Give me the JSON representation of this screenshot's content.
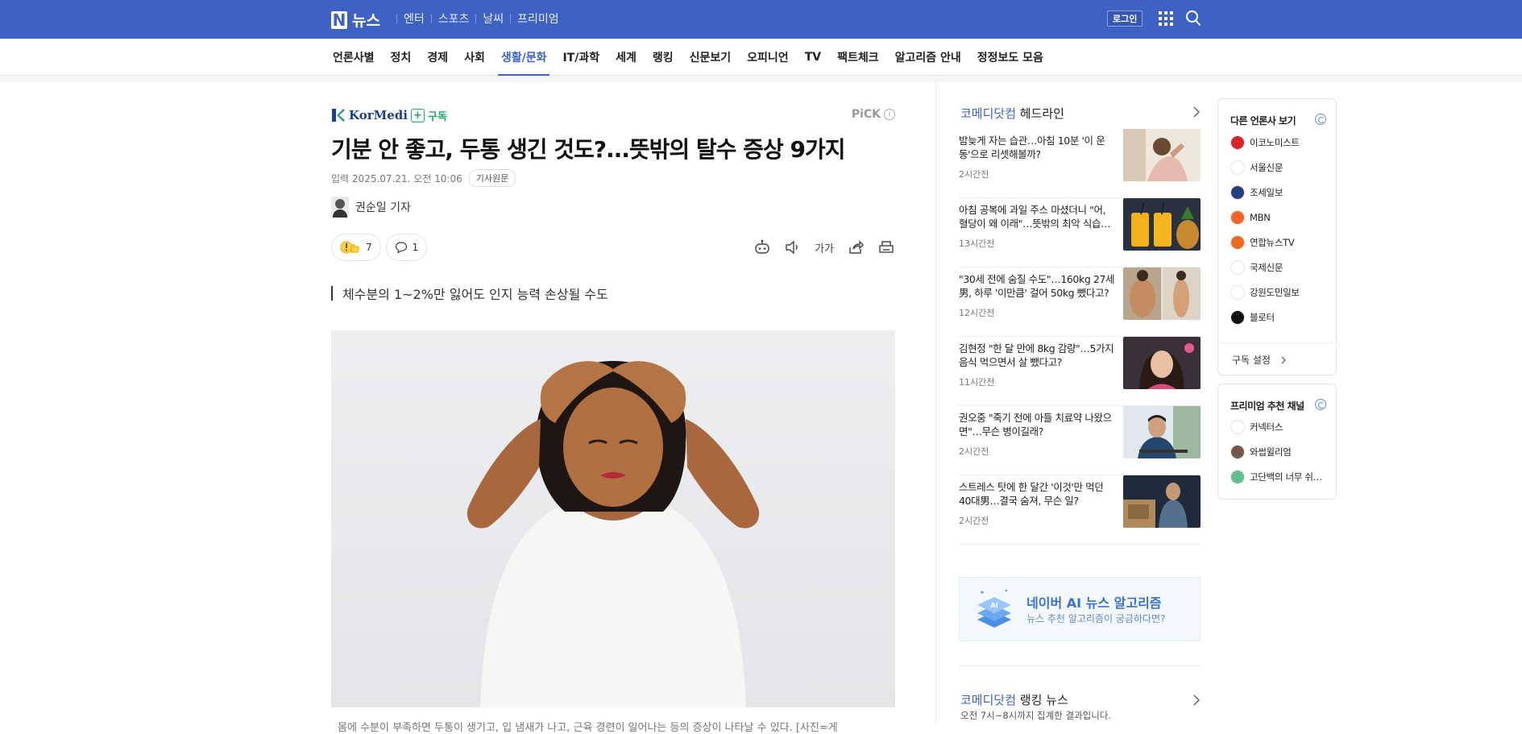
{
  "header": {
    "logo_letter": "N",
    "logo_word": "뉴스",
    "nav": [
      "엔터",
      "스포츠",
      "날씨",
      "프리미엄"
    ],
    "login_label": "로그인"
  },
  "categories": [
    "언론사별",
    "정치",
    "경제",
    "사회",
    "생활/문화",
    "IT/과학",
    "세계",
    "랭킹",
    "신문보기",
    "오피니언",
    "TV",
    "팩트체크",
    "알고리즘 안내",
    "정정보도 모음"
  ],
  "active_category": "생활/문화",
  "article": {
    "press_name": "KorMedi",
    "subscribe_label": "구독",
    "pick_label": "PiCK",
    "pick_info": "i",
    "title": "기분 안 좋고, 두통 생긴 것도?...뜻밖의 탈수 증상 9가지",
    "input_label": "입력",
    "date": "2025.07.21. 오전 10:06",
    "original_label": "기사원문",
    "reporter": "권순일 기자",
    "reaction_count": "7",
    "comment_count": "1",
    "font_size_label": "가가",
    "subtitle": "체수분의 1~2%만 잃어도 인지 능력 손상될 수도",
    "caption": "몸에 수분이 부족하면 두통이 생기고, 입 냄새가 나고, 근육 경련이 일어나는 등의 증상이 나타날 수 있다. [사진=게"
  },
  "headlines": {
    "brand": "코메디닷컴",
    "title_suffix": " 헤드라인",
    "items": [
      {
        "text": "밤늦게 자는 습관…아침 10분 '이 운동'으로 리셋해볼까?",
        "time": "2시간전"
      },
      {
        "text": "아침 공복에 과일 주스 마셨더니 \"어, 혈당이 왜 이래\"…뜻밖의 최악 식습…",
        "time": "13시간전"
      },
      {
        "text": "\"30세 전에 숨질 수도\"…160kg 27세 男, 하루 '이만큼' 걸어 50kg 뺐다고?",
        "time": "12시간전"
      },
      {
        "text": "김현정 \"한 달 만에 8kg 감량\"…5가지 음식 먹으면서 살 뺐다고?",
        "time": "11시간전"
      },
      {
        "text": "권오중 \"죽기 전에 아들 치료약 나왔으면\"…무슨 병이길래?",
        "time": "2시간전"
      },
      {
        "text": "스트레스 탓에 한 달간 '이것'만 먹던 40대男…결국 숨져, 무슨 일?",
        "time": "2시간전"
      }
    ],
    "ai_title": "네이버 AI 뉴스 알고리즘",
    "ai_subtitle": "뉴스 추천 알고리즘이 궁금하다면?",
    "ai_badge": "AI",
    "ranking_brand": "코메디닷컴",
    "ranking_suffix": " 랭킹 뉴스",
    "ranking_sub": "오전 7시~8시까지 집계한 결과입니다."
  },
  "other_press": {
    "title": "다른 언론사 보기",
    "items": [
      {
        "name": "이코노미스트",
        "color": "#d6262b"
      },
      {
        "name": "서울신문",
        "color": "#ffffff"
      },
      {
        "name": "조세일보",
        "color": "#1f3f86"
      },
      {
        "name": "MBN",
        "color": "#f26522"
      },
      {
        "name": "연합뉴스TV",
        "color": "#f0691f"
      },
      {
        "name": "국제신문",
        "color": "#ffffff"
      },
      {
        "name": "강원도민일보",
        "color": "#ffffff"
      },
      {
        "name": "블로터",
        "color": "#111111"
      }
    ],
    "footer": "구독 설정"
  },
  "premium": {
    "title": "프리미엄 추천 채널",
    "items": [
      {
        "name": "커넥터스",
        "color": "#ffffff"
      },
      {
        "name": "와썹윌리엄",
        "color": "#6e5a48"
      },
      {
        "name": "고단백의 너무 쉬…",
        "color": "#5fbf8f"
      }
    ]
  },
  "colors": {
    "brand": "#3d62c4",
    "subscribe": "#21a865"
  }
}
